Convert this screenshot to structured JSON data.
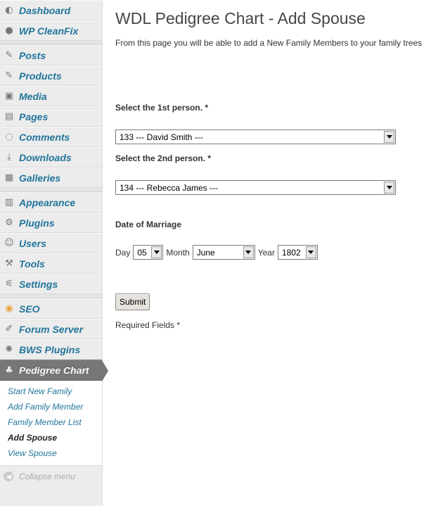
{
  "sidebar": {
    "items": [
      {
        "label": "Dashboard",
        "icon": "dashboard-icon"
      },
      {
        "label": "WP CleanFix",
        "icon": "globe-icon"
      },
      {
        "label": "Posts",
        "icon": "pin-icon"
      },
      {
        "label": "Products",
        "icon": "pin-icon"
      },
      {
        "label": "Media",
        "icon": "media-icon"
      },
      {
        "label": "Pages",
        "icon": "pages-icon"
      },
      {
        "label": "Comments",
        "icon": "comment-icon"
      },
      {
        "label": "Downloads",
        "icon": "download-icon"
      },
      {
        "label": "Galleries",
        "icon": "gallery-icon"
      },
      {
        "label": "Appearance",
        "icon": "appearance-icon"
      },
      {
        "label": "Plugins",
        "icon": "plugin-icon"
      },
      {
        "label": "Users",
        "icon": "users-icon"
      },
      {
        "label": "Tools",
        "icon": "tools-icon"
      },
      {
        "label": "Settings",
        "icon": "settings-icon"
      },
      {
        "label": "SEO",
        "icon": "seo-icon"
      },
      {
        "label": "Forum Server",
        "icon": "pencil-icon"
      },
      {
        "label": "BWS Plugins",
        "icon": "swirl-icon"
      },
      {
        "label": "Pedigree Chart",
        "icon": "tree-icon"
      }
    ],
    "submenu": [
      "Start New Family",
      "Add Family Member",
      "Family Member List",
      "Add Spouse",
      "View Spouse"
    ],
    "collapse": "Collapse menu"
  },
  "main": {
    "title": "WDL Pedigree Chart - Add Spouse",
    "intro": "From this page you will be able to add a New Family Members to your family trees",
    "first_label": "Select the 1st person. *",
    "first_value": "133 --- David Smith ---",
    "second_label": "Select the 2nd person. *",
    "second_value": "134 --- Rebecca James ---",
    "marriage_label": "Date of Marriage",
    "day_label": "Day",
    "day_value": "05",
    "month_label": "Month",
    "month_value": "June",
    "year_label": "Year",
    "year_value": "1802",
    "submit": "Submit",
    "required": "Required Fields *"
  },
  "colors": {
    "link": "#21759b",
    "active_bg": "#777777",
    "sidebar_bg": "#ececec"
  }
}
